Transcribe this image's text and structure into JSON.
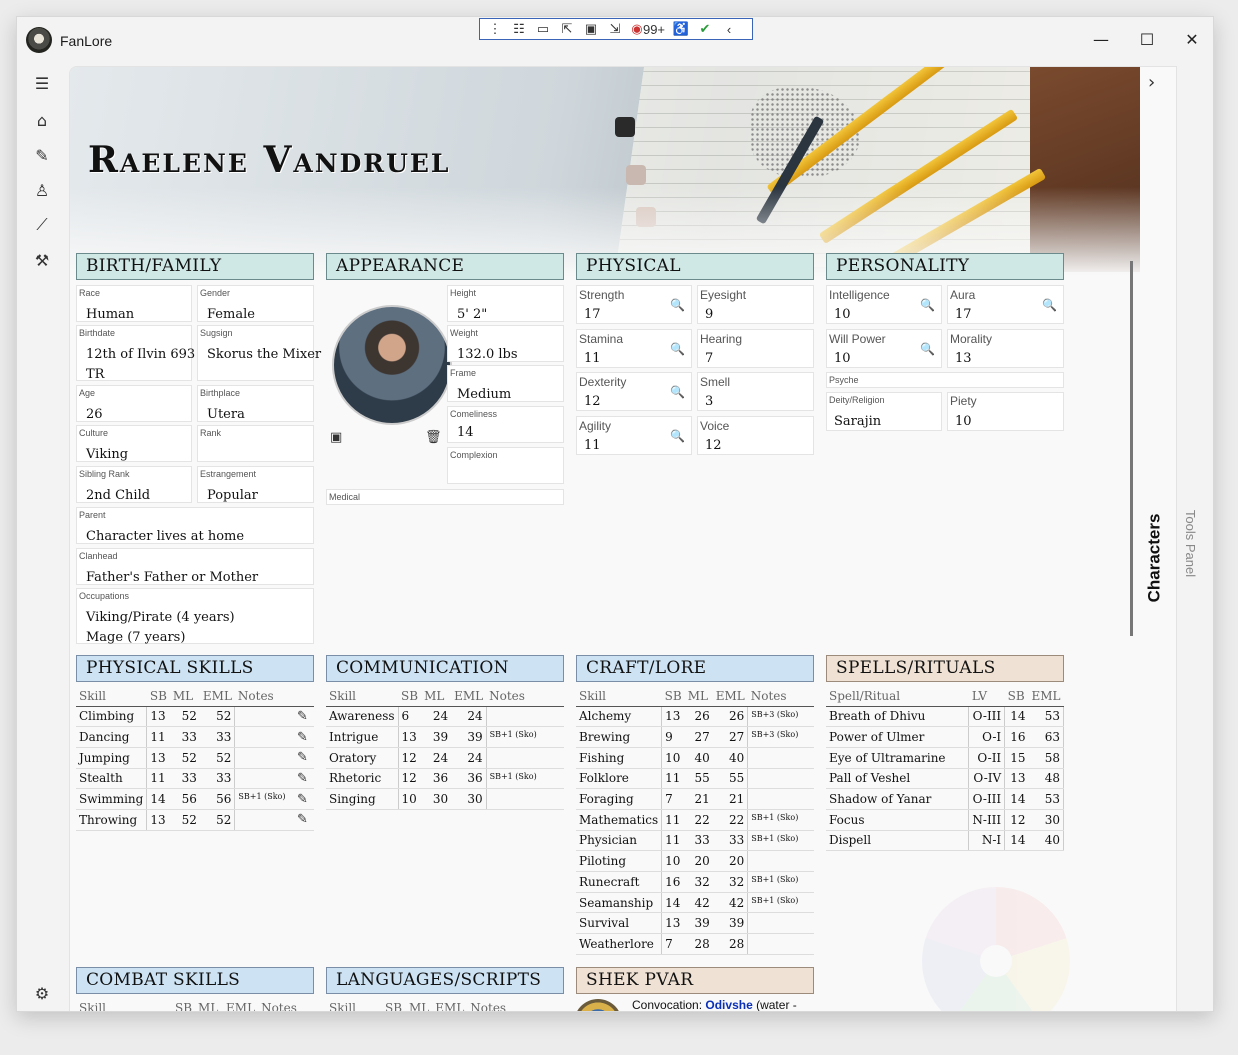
{
  "window": {
    "title": "FanLore"
  },
  "devbar": {
    "counter": "99+"
  },
  "character": {
    "name": "Raelene Vandruel"
  },
  "sections": {
    "birth": "BIRTH/FAMILY",
    "appearance": "APPEARANCE",
    "physical": "PHYSICAL",
    "personality": "PERSONALITY",
    "physical_skills": "PHYSICAL SKILLS",
    "communication": "COMMUNICATION",
    "craft": "CRAFT/LORE",
    "spells": "SPELLS/RITUALS",
    "combat": "COMBAT SKILLS",
    "languages": "LANGUAGES/SCRIPTS",
    "shek": "SHEK PVAR"
  },
  "birth": {
    "race": {
      "label": "Race",
      "value": "Human"
    },
    "gender": {
      "label": "Gender",
      "value": "Female"
    },
    "birthdate": {
      "label": "Birthdate",
      "line1": "12th of Ilvin 693",
      "line2": "TR"
    },
    "sugsign": {
      "label": "Sugsign",
      "value": "Skorus the Mixer"
    },
    "age": {
      "label": "Age",
      "value": "26"
    },
    "birthplace": {
      "label": "Birthplace",
      "value": "Utera"
    },
    "culture": {
      "label": "Culture",
      "value": "Viking"
    },
    "rank": {
      "label": "Rank",
      "value": ""
    },
    "sibling_rank": {
      "label": "Sibling Rank",
      "value": "2nd Child"
    },
    "estrangement": {
      "label": "Estrangement",
      "value": "Popular"
    },
    "parent": {
      "label": "Parent",
      "value": "Character lives at home"
    },
    "clanhead": {
      "label": "Clanhead",
      "value": "Father's Father or Mother"
    },
    "occupations": {
      "label": "Occupations",
      "line1": "Viking/Pirate (4 years)",
      "line2": "Mage (7 years)"
    }
  },
  "appearance": {
    "height": {
      "label": "Height",
      "value": "5' 2\""
    },
    "weight": {
      "label": "Weight",
      "value": "132.0 lbs"
    },
    "frame": {
      "label": "Frame",
      "value": "Medium"
    },
    "comeliness": {
      "label": "Comeliness",
      "value": "14"
    },
    "complexion": {
      "label": "Complexion",
      "value": ""
    },
    "medical": {
      "label": "Medical",
      "value": ""
    }
  },
  "physical": {
    "strength": {
      "label": "Strength",
      "value": "17"
    },
    "eyesight": {
      "label": "Eyesight",
      "value": "9"
    },
    "stamina": {
      "label": "Stamina",
      "value": "11"
    },
    "hearing": {
      "label": "Hearing",
      "value": "7"
    },
    "dexterity": {
      "label": "Dexterity",
      "value": "12"
    },
    "smell": {
      "label": "Smell",
      "value": "3"
    },
    "agility": {
      "label": "Agility",
      "value": "11"
    },
    "voice": {
      "label": "Voice",
      "value": "12"
    }
  },
  "personality": {
    "intelligence": {
      "label": "Intelligence",
      "value": "10"
    },
    "aura": {
      "label": "Aura",
      "value": "17"
    },
    "will": {
      "label": "Will Power",
      "value": "10"
    },
    "morality": {
      "label": "Morality",
      "value": "13"
    },
    "psyche": {
      "label": "Psyche",
      "value": ""
    },
    "deity": {
      "label": "Deity/Religion",
      "value": "Sarajin"
    },
    "piety": {
      "label": "Piety",
      "value": "10"
    }
  },
  "skill_headers": {
    "skill": "Skill",
    "sb": "SB",
    "ml": "ML",
    "eml": "EML",
    "notes": "Notes",
    "spell": "Spell/Ritual",
    "lv": "LV"
  },
  "physical_skills": [
    {
      "name": "Climbing",
      "sb": "13",
      "ml": "52",
      "eml": "52",
      "notes": ""
    },
    {
      "name": "Dancing",
      "sb": "11",
      "ml": "33",
      "eml": "33",
      "notes": ""
    },
    {
      "name": "Jumping",
      "sb": "13",
      "ml": "52",
      "eml": "52",
      "notes": ""
    },
    {
      "name": "Stealth",
      "sb": "11",
      "ml": "33",
      "eml": "33",
      "notes": ""
    },
    {
      "name": "Swimming",
      "sb": "14",
      "ml": "56",
      "eml": "56",
      "notes": "SB+1 (Sko)"
    },
    {
      "name": "Throwing",
      "sb": "13",
      "ml": "52",
      "eml": "52",
      "notes": ""
    }
  ],
  "communication": [
    {
      "name": "Awareness",
      "sb": "6",
      "ml": "24",
      "eml": "24",
      "notes": ""
    },
    {
      "name": "Intrigue",
      "sb": "13",
      "ml": "39",
      "eml": "39",
      "notes": "SB+1 (Sko)"
    },
    {
      "name": "Oratory",
      "sb": "12",
      "ml": "24",
      "eml": "24",
      "notes": ""
    },
    {
      "name": "Rhetoric",
      "sb": "12",
      "ml": "36",
      "eml": "36",
      "notes": "SB+1 (Sko)"
    },
    {
      "name": "Singing",
      "sb": "10",
      "ml": "30",
      "eml": "30",
      "notes": ""
    }
  ],
  "craft": [
    {
      "name": "Alchemy",
      "sb": "13",
      "ml": "26",
      "eml": "26",
      "notes": "SB+3 (Sko)"
    },
    {
      "name": "Brewing",
      "sb": "9",
      "ml": "27",
      "eml": "27",
      "notes": "SB+3 (Sko)"
    },
    {
      "name": "Fishing",
      "sb": "10",
      "ml": "40",
      "eml": "40",
      "notes": ""
    },
    {
      "name": "Folklore",
      "sb": "11",
      "ml": "55",
      "eml": "55",
      "notes": ""
    },
    {
      "name": "Foraging",
      "sb": "7",
      "ml": "21",
      "eml": "21",
      "notes": ""
    },
    {
      "name": "Mathematics",
      "sb": "11",
      "ml": "22",
      "eml": "22",
      "notes": "SB+1 (Sko)"
    },
    {
      "name": "Physician",
      "sb": "11",
      "ml": "33",
      "eml": "33",
      "notes": "SB+1 (Sko)"
    },
    {
      "name": "Piloting",
      "sb": "10",
      "ml": "20",
      "eml": "20",
      "notes": ""
    },
    {
      "name": "Runecraft",
      "sb": "16",
      "ml": "32",
      "eml": "32",
      "notes": "SB+1 (Sko)"
    },
    {
      "name": "Seamanship",
      "sb": "14",
      "ml": "42",
      "eml": "42",
      "notes": "SB+1 (Sko)"
    },
    {
      "name": "Survival",
      "sb": "13",
      "ml": "39",
      "eml": "39",
      "notes": ""
    },
    {
      "name": "Weatherlore",
      "sb": "7",
      "ml": "28",
      "eml": "28",
      "notes": ""
    }
  ],
  "spells": [
    {
      "name": "Breath of Dhivu",
      "lv": "O-III",
      "sb": "14",
      "eml": "53"
    },
    {
      "name": "Power of Ulmer",
      "lv": "O-I",
      "sb": "16",
      "eml": "63"
    },
    {
      "name": "Eye of Ultramarine",
      "lv": "O-II",
      "sb": "15",
      "eml": "58"
    },
    {
      "name": "Pall of Veshel",
      "lv": "O-IV",
      "sb": "13",
      "eml": "48"
    },
    {
      "name": "Shadow of Yanar",
      "lv": "O-III",
      "sb": "14",
      "eml": "53"
    },
    {
      "name": "Focus",
      "lv": "N-III",
      "sb": "12",
      "eml": "30"
    },
    {
      "name": "Dispell",
      "lv": "N-I",
      "sb": "14",
      "eml": "40"
    }
  ],
  "shek": {
    "label": "Convocation:",
    "value": "Odivshe",
    "suffix": "(water -"
  },
  "right_panel": {
    "characters": "Characters",
    "tools": "Tools Panel"
  },
  "colors": {
    "teal_header": "#cfe8e6",
    "blue_header": "#cde3f4",
    "tan_header": "#efe1d3",
    "link": "#0a2fb8"
  }
}
